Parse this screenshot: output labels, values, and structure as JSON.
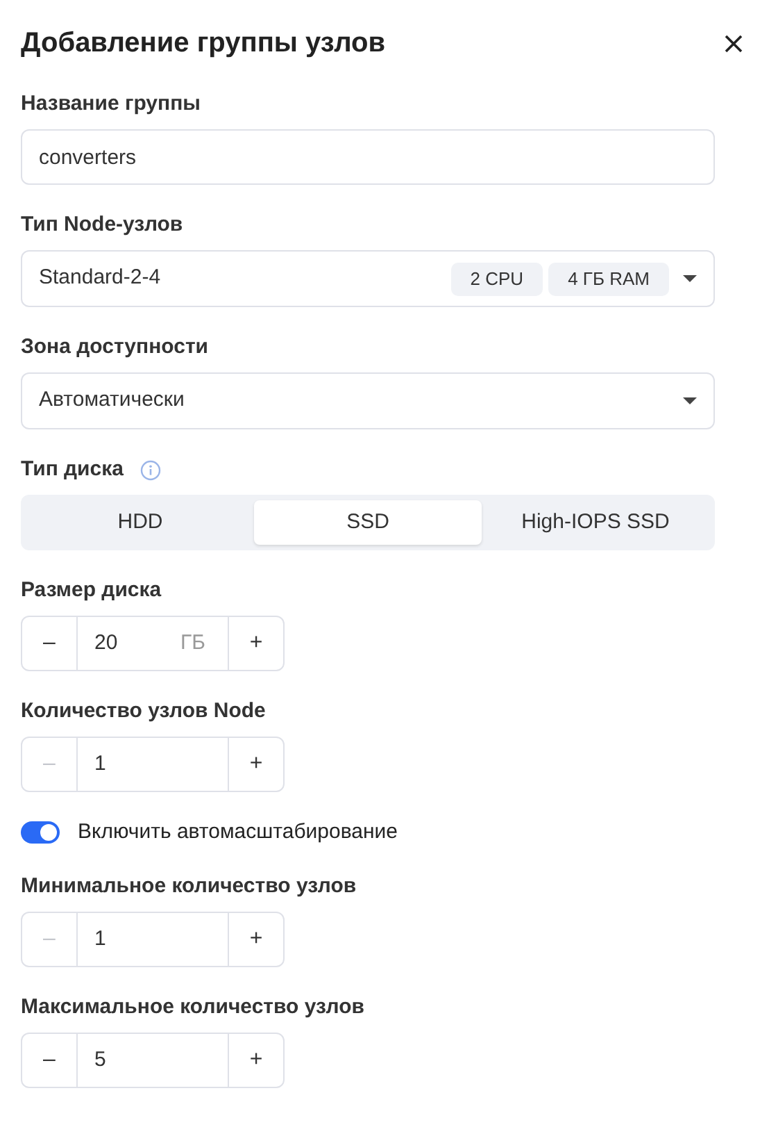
{
  "title": "Добавление группы узлов",
  "fields": [
    {
      "kind": "text",
      "label": "Название группы",
      "value": "converters"
    },
    {
      "kind": "select",
      "label": "Тип Node-узлов",
      "value": "Standard-2-4",
      "chips": [
        "2 CPU",
        "4 ГБ RAM"
      ]
    },
    {
      "kind": "select",
      "label": "Зона доступности",
      "value": "Автоматически"
    },
    {
      "kind": "segmented",
      "label": "Тип диска",
      "info": true,
      "options": [
        {
          "label": "HDD",
          "selected": false
        },
        {
          "label": "SSD",
          "selected": true
        },
        {
          "label": "High-IOPS SSD",
          "selected": false
        }
      ]
    },
    {
      "kind": "stepper",
      "label": "Размер диска",
      "value": "20",
      "unit": "ГБ",
      "minus": "–",
      "plus": "+",
      "minus_disabled": false
    },
    {
      "kind": "stepper",
      "label": "Количество узлов Node",
      "value": "1",
      "minus": "–",
      "plus": "+",
      "minus_disabled": true
    },
    {
      "kind": "toggle",
      "label": "Включить автомасштабирование",
      "on": true
    },
    {
      "kind": "stepper",
      "label": "Минимальное количество узлов",
      "value": "1",
      "minus": "–",
      "plus": "+",
      "minus_disabled": true
    },
    {
      "kind": "stepper",
      "label": "Максимальное количество узлов",
      "value": "5",
      "minus": "–",
      "plus": "+",
      "minus_disabled": false
    }
  ]
}
